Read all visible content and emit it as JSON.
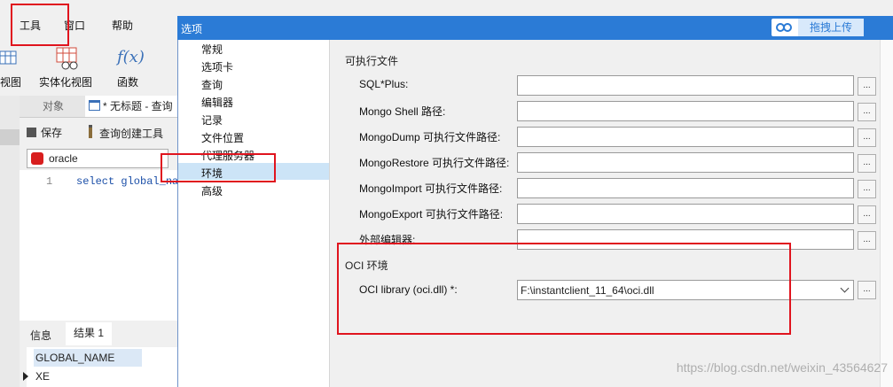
{
  "menu": {
    "tools": "工具",
    "window": "窗口",
    "help": "帮助"
  },
  "toolbar": {
    "view_label": "视图",
    "entity_view_label": "实体化视图",
    "function_label": "函数",
    "function_glyph": "f(x)"
  },
  "tabs": {
    "objects": "对象",
    "query_tab": "* 无标题 - 查询"
  },
  "actions": {
    "save": "保存",
    "query_builder": "查询创建工具"
  },
  "connection": {
    "name": "oracle"
  },
  "editor": {
    "line_no": "1",
    "code": "select global_na"
  },
  "results": {
    "info_tab": "信息",
    "result_tab": "结果 1",
    "column": "GLOBAL_NAME",
    "row_value": "XE"
  },
  "dialog": {
    "title": "选项",
    "upload_button": "拖拽上传",
    "tree": [
      "常规",
      "选项卡",
      "查询",
      "编辑器",
      "记录",
      "文件位置",
      "代理服务器",
      "环境",
      "高级"
    ],
    "selected_tree_item": "环境",
    "exec_section": "可执行文件",
    "fields": [
      {
        "label": "SQL*Plus:",
        "value": ""
      },
      {
        "label": "Mongo Shell 路径:",
        "value": ""
      },
      {
        "label": "MongoDump 可执行文件路径:",
        "value": ""
      },
      {
        "label": "MongoRestore 可执行文件路径:",
        "value": ""
      },
      {
        "label": "MongoImport 可执行文件路径:",
        "value": ""
      },
      {
        "label": "MongoExport 可执行文件路径:",
        "value": ""
      },
      {
        "label": "外部编辑器:",
        "value": ""
      }
    ],
    "browse_label": "...",
    "oci_section": "OCI 环境",
    "oci_label": "OCI library (oci.dll) *:",
    "oci_value": "F:\\instantclient_11_64\\oci.dll"
  },
  "watermark": "https://blog.csdn.net/weixin_43564627",
  "colors": {
    "title_bar": "#2b7bd6",
    "selection": "#cce4f7",
    "highlight_box": "#e0141e"
  }
}
